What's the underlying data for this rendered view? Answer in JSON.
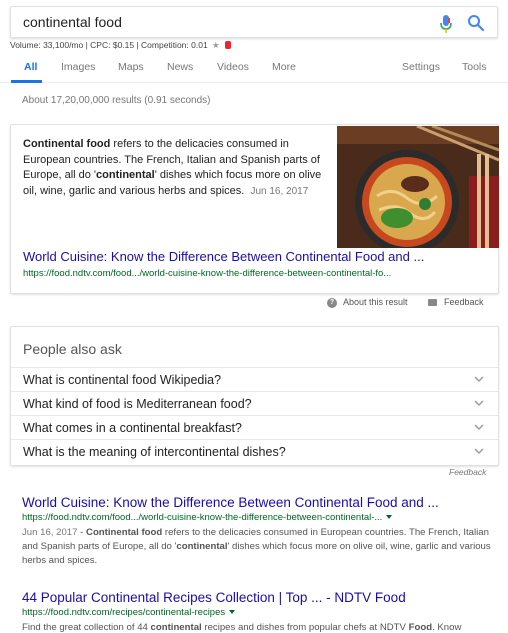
{
  "search": {
    "query": "continental food"
  },
  "keyword_info": {
    "text": "Volume: 33,100/mo | CPC: $0.15 | Competition: 0.01"
  },
  "tabs": [
    {
      "label": "All"
    },
    {
      "label": "Images"
    },
    {
      "label": "Maps"
    },
    {
      "label": "News"
    },
    {
      "label": "Videos"
    },
    {
      "label": "More"
    },
    {
      "label": "Settings"
    },
    {
      "label": "Tools"
    }
  ],
  "stats": "About 17,20,00,000 results (0.91 seconds)",
  "featured_snippet": {
    "bold_lead": "Continental food",
    "text_1": " refers to the delicacies consumed in European countries. The French, Italian and Spanish parts of Europe, all do '",
    "bold_mid": "continental",
    "text_2": "' dishes which focus more on olive oil, wine, garlic and various herbs and spices.",
    "date": "Jun 16, 2017",
    "link_title": "World Cuisine: Know the Difference Between Continental Food and ...",
    "url": "https://food.ndtv.com/food.../world-cuisine-know-the-difference-between-continental-fo...",
    "about_label": "About this result",
    "feedback_label": "Feedback"
  },
  "people_also_ask": {
    "title": "People also ask",
    "questions": [
      "What is continental food Wikipedia?",
      "What kind of food is Mediterranean food?",
      "What comes in a continental breakfast?",
      "What is the meaning of intercontinental dishes?"
    ],
    "feedback_label": "Feedback"
  },
  "results": [
    {
      "title": "World Cuisine: Know the Difference Between Continental Food and ...",
      "url": "https://food.ndtv.com/food.../world-cuisine-know-the-difference-between-continental-...",
      "date": "Jun 16, 2017",
      "sep": " - ",
      "bold_lead": "Continental food",
      "text_1": " refers to the delicacies consumed in European countries. The French, Italian and Spanish parts of Europe, all do '",
      "bold_mid": "continental",
      "text_2": "' dishes which focus more on olive oil, wine, garlic and various herbs and spices."
    },
    {
      "title": "44 Popular Continental Recipes Collection | Top ... - NDTV Food",
      "url": "https://food.ndtv.com/recipes/continental-recipes",
      "text_1": "Find the great collection of 44 ",
      "bold_lead": "continental",
      "text_2": " recipes and dishes from popular chefs at NDTV ",
      "bold_mid": "Food",
      "text_3": ". Know"
    }
  ],
  "colors": {
    "link": "#1a0dab",
    "url": "#006621",
    "accent": "#1a73e8"
  },
  "icons": {
    "mic": "microphone-icon",
    "search": "search-icon",
    "about": "question-circle-icon",
    "feedback": "feedback-icon",
    "expand": "chevron-down-icon"
  }
}
